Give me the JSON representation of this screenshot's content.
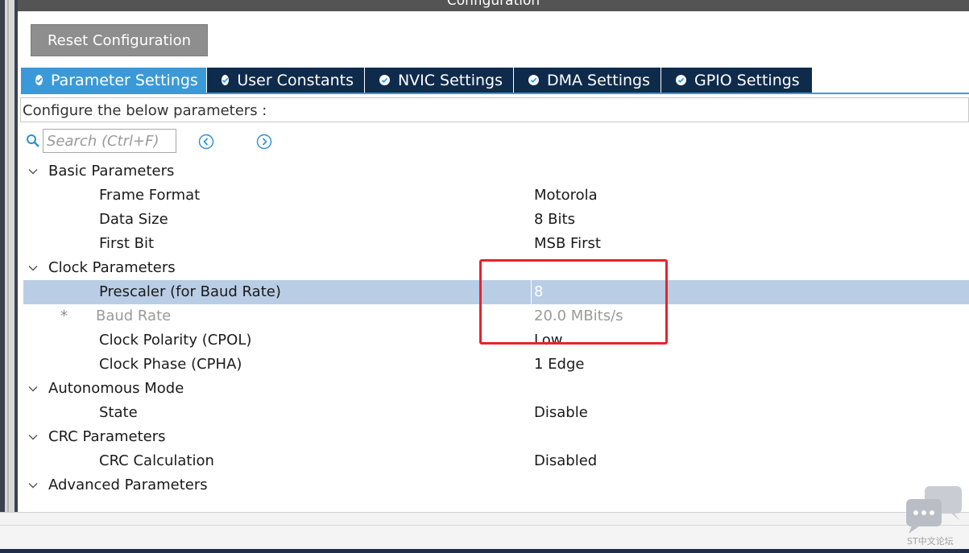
{
  "window": {
    "title": "Configuration"
  },
  "toolbar": {
    "reset_label": "Reset Configuration"
  },
  "tabs": [
    {
      "label": "Parameter Settings",
      "active": true
    },
    {
      "label": "User Constants",
      "active": false
    },
    {
      "label": "NVIC Settings",
      "active": false
    },
    {
      "label": "DMA Settings",
      "active": false
    },
    {
      "label": "GPIO Settings",
      "active": false
    }
  ],
  "configure_hint": "Configure the below parameters :",
  "search": {
    "placeholder": "Search (Ctrl+F)"
  },
  "groups": [
    {
      "label": "Basic Parameters",
      "params": [
        {
          "label": "Frame Format",
          "value": "Motorola"
        },
        {
          "label": "Data Size",
          "value": "8 Bits"
        },
        {
          "label": "First Bit",
          "value": "MSB First"
        }
      ]
    },
    {
      "label": "Clock Parameters",
      "params": [
        {
          "label": "Prescaler (for Baud Rate)",
          "value": "8",
          "selected": true
        },
        {
          "label": "Baud Rate",
          "value": "20.0 MBits/s",
          "marker": "*",
          "disabled": true
        },
        {
          "label": "Clock Polarity (CPOL)",
          "value": "Low"
        },
        {
          "label": "Clock Phase (CPHA)",
          "value": "1 Edge"
        }
      ]
    },
    {
      "label": "Autonomous Mode",
      "params": [
        {
          "label": "State",
          "value": "Disable"
        }
      ]
    },
    {
      "label": "CRC Parameters",
      "params": [
        {
          "label": "CRC Calculation",
          "value": "Disabled"
        }
      ]
    },
    {
      "label": "Advanced Parameters",
      "params": []
    }
  ],
  "watermark": "ST中文论坛",
  "colors": {
    "tab_bg": "#0f2b4c",
    "tab_active": "#3a9ad9",
    "selected_row": "#b9cde5",
    "annotation": "#e8232a"
  }
}
